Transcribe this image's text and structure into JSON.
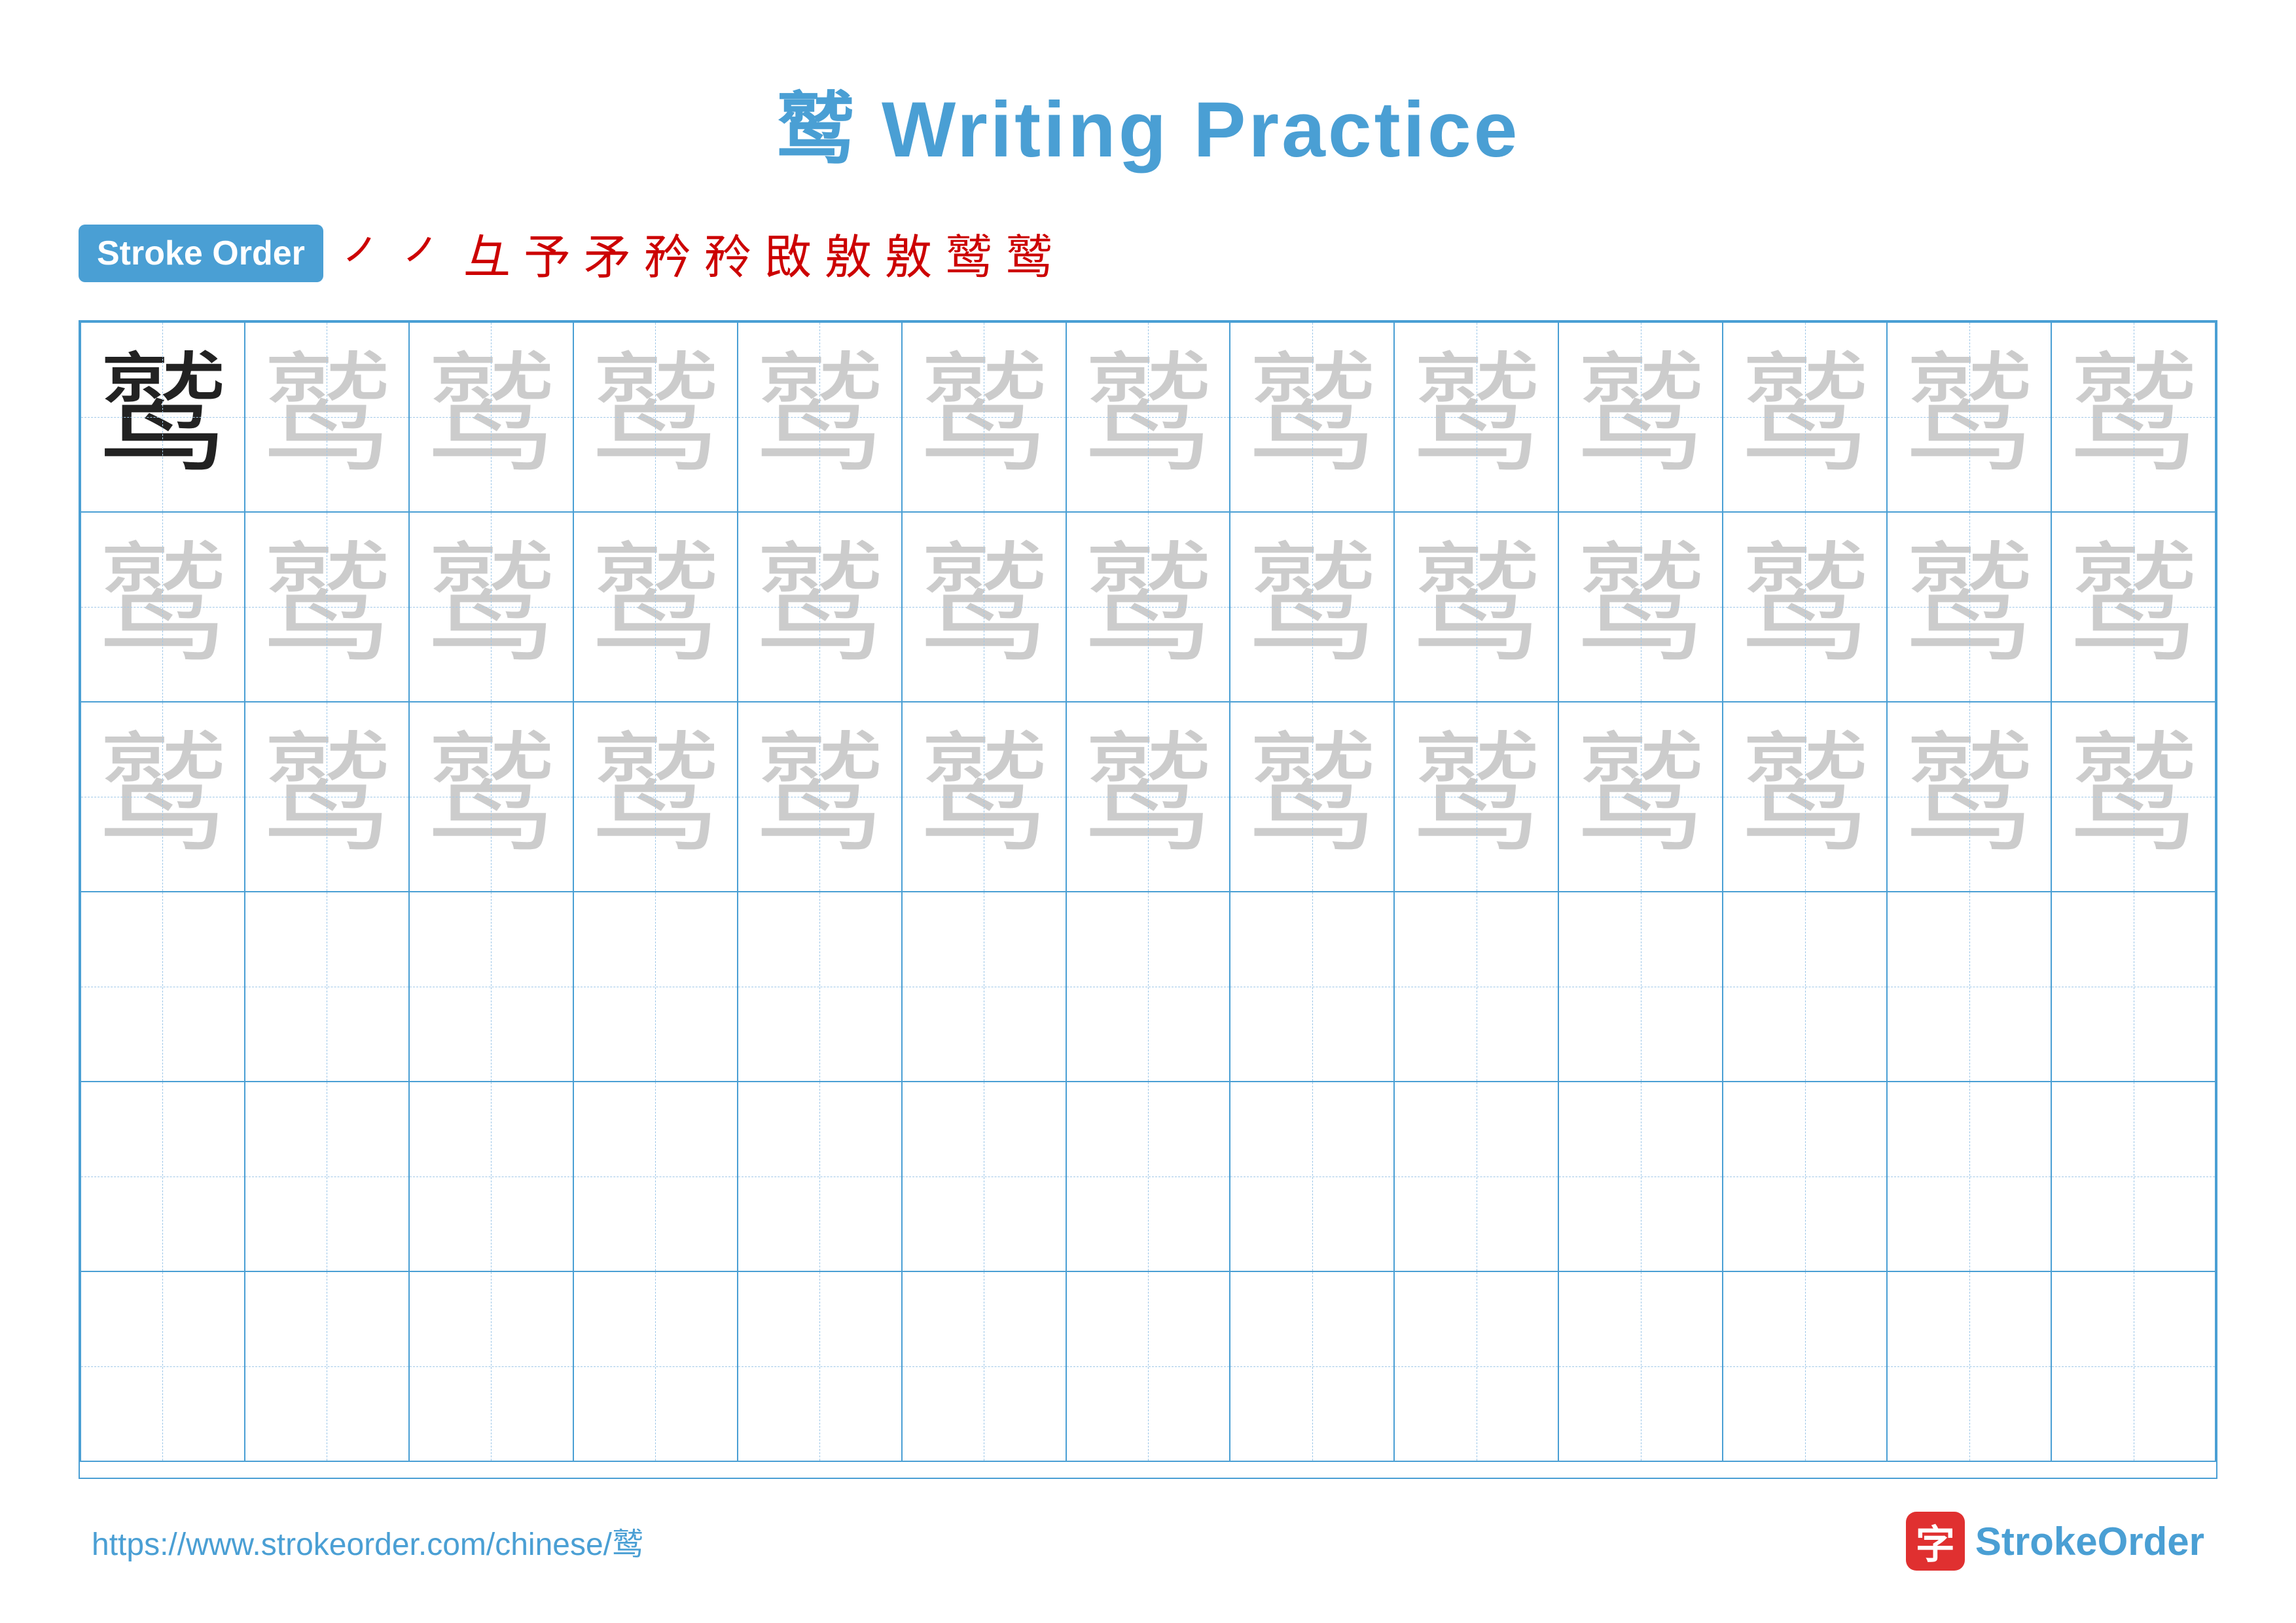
{
  "title": {
    "char": "鹫",
    "suffix": " Writing Practice"
  },
  "stroke_order": {
    "badge_label": "Stroke Order",
    "steps": [
      "⺊",
      "⺊",
      "彑",
      "予",
      "矛",
      "矜",
      "矜",
      "敄",
      "敫",
      "敫",
      "鹫",
      "鹫"
    ]
  },
  "grid": {
    "rows": 6,
    "cols": 13,
    "char": "鹫",
    "dark_count": 1,
    "light_rows": 3
  },
  "footer": {
    "url": "https://www.strokeorder.com/chinese/鹫",
    "brand_char": "字",
    "brand_name_part1": "Stroke",
    "brand_name_part2": "Order"
  }
}
